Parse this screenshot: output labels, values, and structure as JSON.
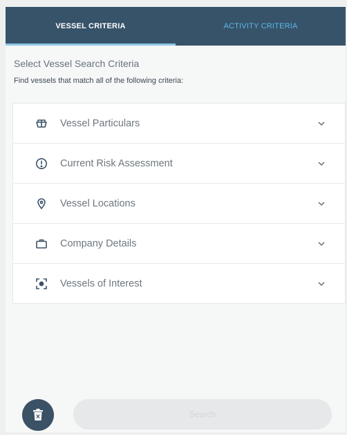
{
  "tabs": {
    "vessel_criteria": "VESSEL CRITERIA",
    "activity_criteria": "ACTIVITY CRITERIA"
  },
  "panel": {
    "heading": "Select Vessel Search Criteria",
    "subheading": "Find vessels that match all of the following criteria:"
  },
  "criteria": [
    {
      "label": "Vessel Particulars",
      "icon": "ship-icon"
    },
    {
      "label": "Current Risk Assessment",
      "icon": "alert-circle-icon"
    },
    {
      "label": "Vessel Locations",
      "icon": "location-pin-icon"
    },
    {
      "label": "Company Details",
      "icon": "briefcase-icon"
    },
    {
      "label": "Vessels of Interest",
      "icon": "target-scan-icon"
    }
  ],
  "footer": {
    "search_label": "Search",
    "delete_icon": "trash-icon"
  },
  "colors": {
    "tab_bar": "#37536a",
    "active_tab_text": "#ffffff",
    "inactive_tab_text": "#5cb9ea",
    "delete_button": "#3b5166"
  }
}
